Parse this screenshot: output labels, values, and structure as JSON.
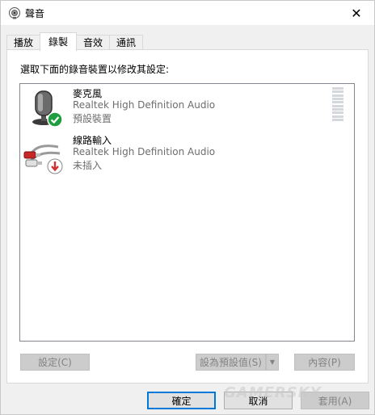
{
  "window": {
    "title": "聲音",
    "app_icon": "speaker-icon",
    "close_glyph": "✕"
  },
  "tabs": [
    {
      "label": "播放",
      "active": false
    },
    {
      "label": "錄製",
      "active": true
    },
    {
      "label": "音效",
      "active": false
    },
    {
      "label": "通訊",
      "active": false
    }
  ],
  "panel": {
    "instruction": "選取下面的錄音裝置以修改其設定:"
  },
  "devices": [
    {
      "name": "麥克風",
      "driver": "Realtek High Definition Audio",
      "status": "預設裝置",
      "icon": "microphone-icon",
      "badge": "default-check-icon",
      "level_fraction": 0
    },
    {
      "name": "線路輸入",
      "driver": "Realtek High Definition Audio",
      "status": "未插入",
      "icon": "rca-cable-icon",
      "badge": "unplugged-arrow-icon"
    }
  ],
  "panel_buttons": {
    "configure": "設定(C)",
    "set_default": "設為預設值(S)",
    "properties": "內容(P)"
  },
  "dialog_buttons": {
    "ok": "確定",
    "cancel": "取消",
    "apply": "套用(A)"
  },
  "watermark": "GAMERSKY",
  "colors": {
    "accent": "#0078d7",
    "check_badge": "#1e9e3e",
    "unplugged_badge": "#d32f2f"
  }
}
